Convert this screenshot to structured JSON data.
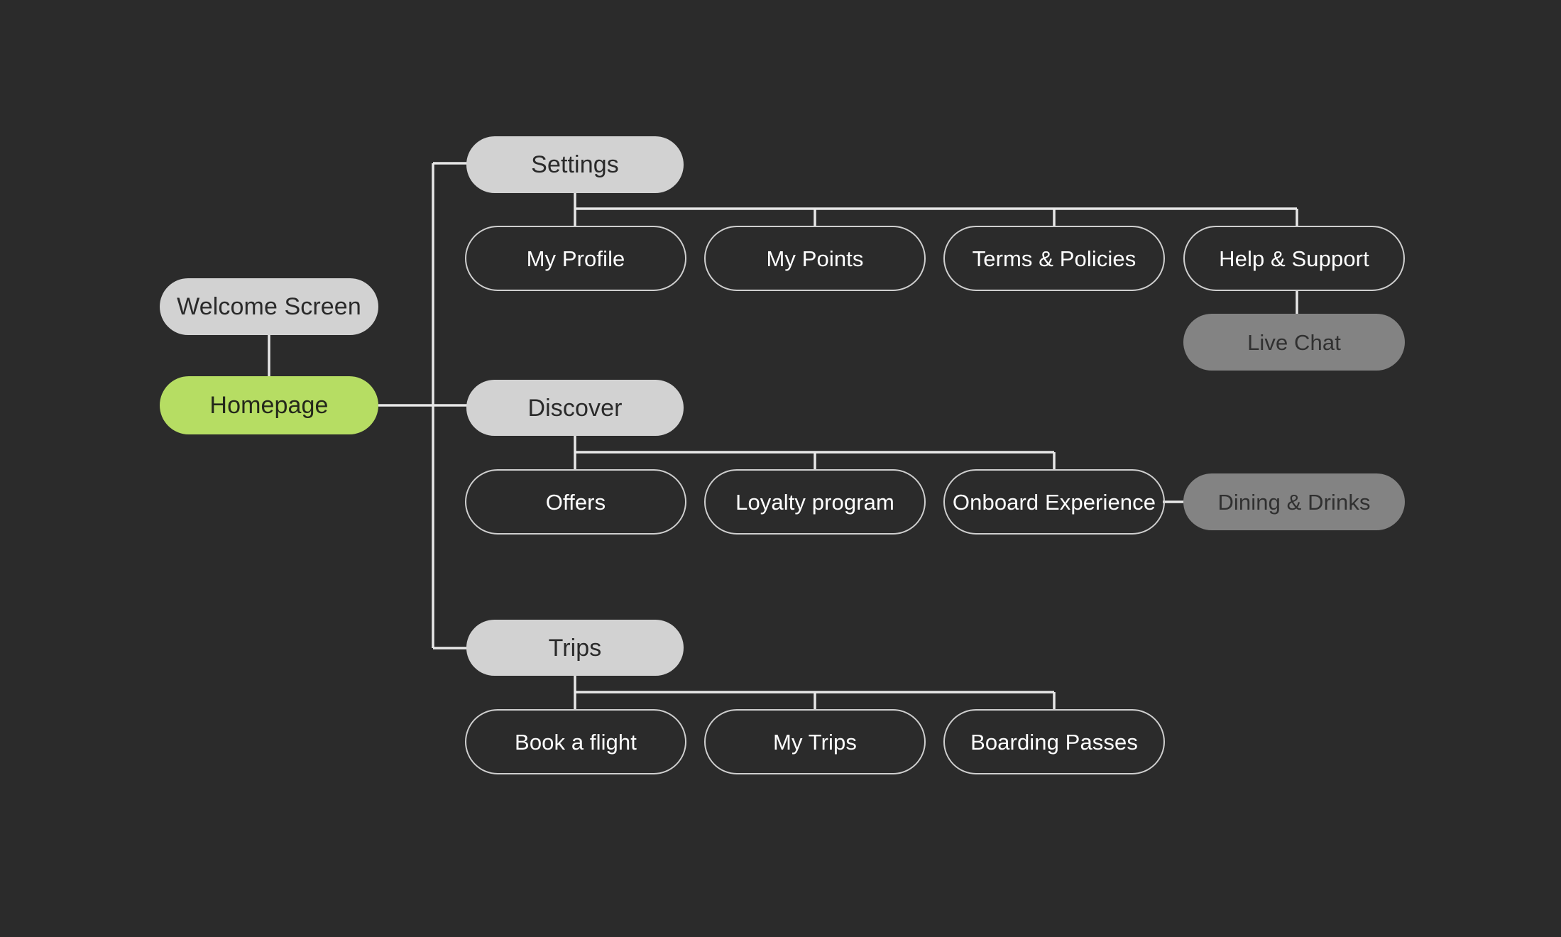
{
  "diagram": {
    "title": "App sitemap flow",
    "background_color": "#2b2b2b",
    "styles": {
      "section_fill": "#d2d2d2",
      "active_fill": "#b6dd63",
      "muted_fill": "#838383",
      "leaf_border": "#cfcfcf",
      "edge_color": "#e8e8e8",
      "dark_text": "#2a2a2a",
      "light_text": "#ffffff"
    },
    "nodes": {
      "welcome_screen": {
        "label": "Welcome Screen",
        "style": "section"
      },
      "homepage": {
        "label": "Homepage",
        "style": "active"
      },
      "settings": {
        "label": "Settings",
        "style": "section"
      },
      "my_profile": {
        "label": "My Profile",
        "style": "leaf"
      },
      "my_points": {
        "label": "My Points",
        "style": "leaf"
      },
      "terms_policies": {
        "label": "Terms & Policies",
        "style": "leaf"
      },
      "help_support": {
        "label": "Help & Support",
        "style": "leaf"
      },
      "live_chat": {
        "label": "Live Chat",
        "style": "muted"
      },
      "discover": {
        "label": "Discover",
        "style": "section"
      },
      "offers": {
        "label": "Offers",
        "style": "leaf"
      },
      "loyalty_program": {
        "label": "Loyalty program",
        "style": "leaf"
      },
      "onboard_experience": {
        "label": "Onboard Experience",
        "style": "leaf"
      },
      "dining_drinks": {
        "label": "Dining & Drinks",
        "style": "muted"
      },
      "trips": {
        "label": "Trips",
        "style": "section"
      },
      "book_a_flight": {
        "label": "Book a flight",
        "style": "leaf"
      },
      "my_trips": {
        "label": "My Trips",
        "style": "leaf"
      },
      "boarding_passes": {
        "label": "Boarding Passes",
        "style": "leaf"
      }
    },
    "edges": [
      {
        "from": "welcome_screen",
        "to": "homepage"
      },
      {
        "from": "homepage",
        "to": "settings"
      },
      {
        "from": "homepage",
        "to": "discover"
      },
      {
        "from": "homepage",
        "to": "trips"
      },
      {
        "from": "settings",
        "to": "my_profile"
      },
      {
        "from": "settings",
        "to": "my_points"
      },
      {
        "from": "settings",
        "to": "terms_policies"
      },
      {
        "from": "settings",
        "to": "help_support"
      },
      {
        "from": "help_support",
        "to": "live_chat"
      },
      {
        "from": "discover",
        "to": "offers"
      },
      {
        "from": "discover",
        "to": "loyalty_program"
      },
      {
        "from": "discover",
        "to": "onboard_experience"
      },
      {
        "from": "onboard_experience",
        "to": "dining_drinks"
      },
      {
        "from": "trips",
        "to": "book_a_flight"
      },
      {
        "from": "trips",
        "to": "my_trips"
      },
      {
        "from": "trips",
        "to": "boarding_passes"
      }
    ]
  }
}
